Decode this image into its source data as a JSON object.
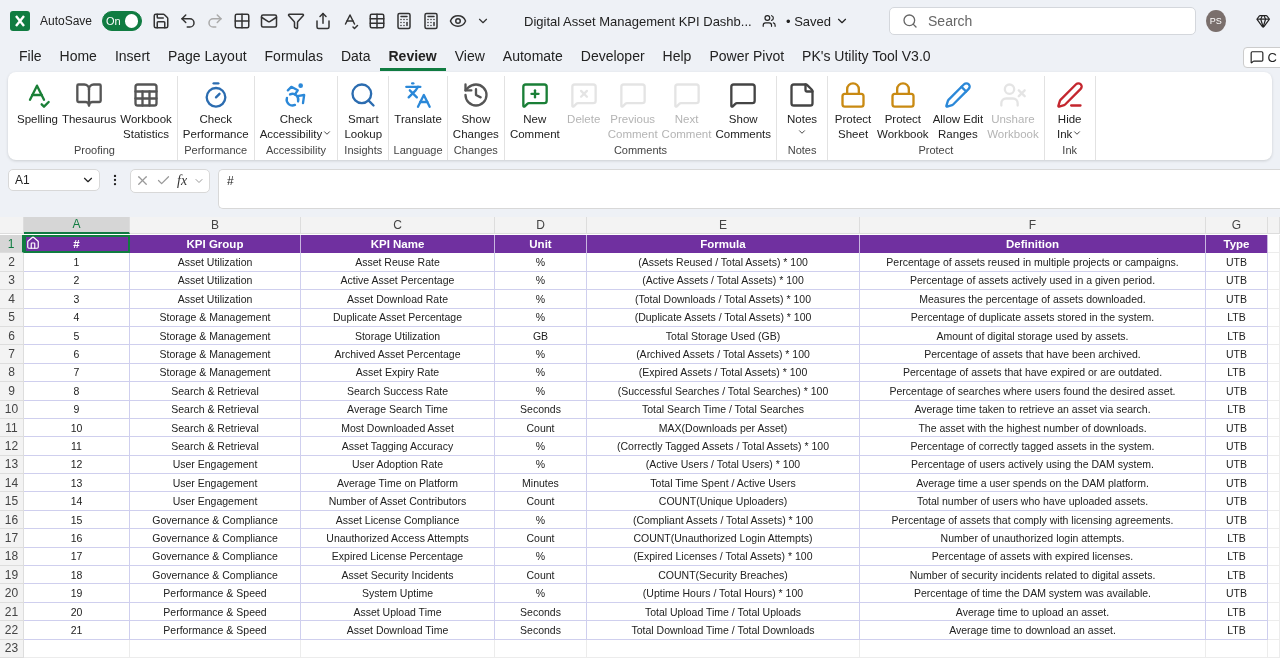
{
  "title_bar": {
    "autosave": {
      "label": "AutoSave",
      "on": true,
      "state": "On"
    },
    "document_title": "Digital Asset Management KPI Dashb...",
    "save_status": "• Saved",
    "search": {
      "placeholder": "Search"
    },
    "avatar": "PS"
  },
  "menu_tabs": [
    {
      "label": "File",
      "selected": false
    },
    {
      "label": "Home",
      "selected": false
    },
    {
      "label": "Insert",
      "selected": false
    },
    {
      "label": "Page Layout",
      "selected": false
    },
    {
      "label": "Formulas",
      "selected": false
    },
    {
      "label": "Data",
      "selected": false
    },
    {
      "label": "Review",
      "selected": true
    },
    {
      "label": "View",
      "selected": false
    },
    {
      "label": "Automate",
      "selected": false
    },
    {
      "label": "Developer",
      "selected": false
    },
    {
      "label": "Help",
      "selected": false
    },
    {
      "label": "Power Pivot",
      "selected": false
    },
    {
      "label": "PK's Utility Tool V3.0",
      "selected": false
    }
  ],
  "comments_button": {
    "label": "C"
  },
  "ribbon": {
    "groups": [
      {
        "label": "Proofing",
        "commands": [
          {
            "lines": [
              "Spelling"
            ],
            "disabled": false,
            "dropdown": false
          },
          {
            "lines": [
              "Thesaurus"
            ],
            "disabled": false,
            "dropdown": false
          },
          {
            "lines": [
              "Workbook",
              "Statistics"
            ],
            "disabled": false,
            "dropdown": false
          }
        ]
      },
      {
        "label": "Performance",
        "commands": [
          {
            "lines": [
              "Check",
              "Performance"
            ],
            "disabled": false,
            "dropdown": false
          }
        ]
      },
      {
        "label": "Accessibility",
        "commands": [
          {
            "lines": [
              "Check",
              "Accessibility"
            ],
            "disabled": false,
            "dropdown": true
          }
        ]
      },
      {
        "label": "Insights",
        "commands": [
          {
            "lines": [
              "Smart",
              "Lookup"
            ],
            "disabled": false,
            "dropdown": false
          }
        ]
      },
      {
        "label": "Language",
        "commands": [
          {
            "lines": [
              "Translate"
            ],
            "disabled": false,
            "dropdown": false
          }
        ]
      },
      {
        "label": "Changes",
        "commands": [
          {
            "lines": [
              "Show",
              "Changes"
            ],
            "disabled": false,
            "dropdown": false
          }
        ]
      },
      {
        "label": "Comments",
        "commands": [
          {
            "lines": [
              "New",
              "Comment"
            ],
            "disabled": false,
            "dropdown": false
          },
          {
            "lines": [
              "Delete"
            ],
            "disabled": true,
            "dropdown": false
          },
          {
            "lines": [
              "Previous",
              "Comment"
            ],
            "disabled": true,
            "dropdown": false
          },
          {
            "lines": [
              "Next",
              "Comment"
            ],
            "disabled": true,
            "dropdown": false
          },
          {
            "lines": [
              "Show",
              "Comments"
            ],
            "disabled": false,
            "dropdown": false
          }
        ]
      },
      {
        "label": "Notes",
        "commands": [
          {
            "lines": [
              "Notes"
            ],
            "disabled": false,
            "dropdown": true
          }
        ]
      },
      {
        "label": "Protect",
        "commands": [
          {
            "lines": [
              "Protect",
              "Sheet"
            ],
            "disabled": false,
            "dropdown": false
          },
          {
            "lines": [
              "Protect",
              "Workbook"
            ],
            "disabled": false,
            "dropdown": false
          },
          {
            "lines": [
              "Allow Edit",
              "Ranges"
            ],
            "disabled": false,
            "dropdown": false
          },
          {
            "lines": [
              "Unshare",
              "Workbook"
            ],
            "disabled": true,
            "dropdown": false
          }
        ]
      },
      {
        "label": "Ink",
        "commands": [
          {
            "lines": [
              "Hide",
              "Ink"
            ],
            "disabled": false,
            "dropdown": true
          }
        ]
      }
    ]
  },
  "formula_bar": {
    "name_box": "A1",
    "function_label": "fx",
    "formula": "#"
  },
  "sheet": {
    "columns": [
      {
        "letter": "A",
        "selected": true
      },
      {
        "letter": "B",
        "selected": false
      },
      {
        "letter": "C",
        "selected": false
      },
      {
        "letter": "D",
        "selected": false
      },
      {
        "letter": "E",
        "selected": false
      },
      {
        "letter": "F",
        "selected": false
      },
      {
        "letter": "G",
        "selected": false
      }
    ],
    "row_headers": [
      {
        "label": "1",
        "selected": true
      },
      {
        "label": "2",
        "selected": false
      },
      {
        "label": "3",
        "selected": false
      },
      {
        "label": "4",
        "selected": false
      },
      {
        "label": "5",
        "selected": false
      },
      {
        "label": "6",
        "selected": false
      },
      {
        "label": "7",
        "selected": false
      },
      {
        "label": "8",
        "selected": false
      },
      {
        "label": "9",
        "selected": false
      },
      {
        "label": "10",
        "selected": false
      },
      {
        "label": "11",
        "selected": false
      },
      {
        "label": "12",
        "selected": false
      },
      {
        "label": "13",
        "selected": false
      },
      {
        "label": "14",
        "selected": false
      },
      {
        "label": "15",
        "selected": false
      },
      {
        "label": "16",
        "selected": false
      },
      {
        "label": "17",
        "selected": false
      },
      {
        "label": "18",
        "selected": false
      },
      {
        "label": "19",
        "selected": false
      },
      {
        "label": "20",
        "selected": false
      },
      {
        "label": "21",
        "selected": false
      },
      {
        "label": "22",
        "selected": false
      },
      {
        "label": "23",
        "selected": false
      }
    ],
    "header": [
      "#",
      "KPI Group",
      "KPI Name",
      "Unit",
      "Formula",
      "Definition",
      "Type"
    ],
    "rows": [
      [
        "1",
        "Asset Utilization",
        "Asset Reuse Rate",
        "%",
        "(Assets Reused / Total Assets) * 100",
        "Percentage of assets reused in multiple projects or campaigns.",
        "UTB"
      ],
      [
        "2",
        "Asset Utilization",
        "Active Asset Percentage",
        "%",
        "(Active Assets / Total Assets) * 100",
        "Percentage of assets actively used in a given period.",
        "UTB"
      ],
      [
        "3",
        "Asset Utilization",
        "Asset Download Rate",
        "%",
        "(Total Downloads / Total Assets) * 100",
        "Measures the percentage of assets downloaded.",
        "UTB"
      ],
      [
        "4",
        "Storage & Management",
        "Duplicate Asset Percentage",
        "%",
        "(Duplicate Assets / Total Assets) * 100",
        "Percentage of duplicate assets stored in the system.",
        "LTB"
      ],
      [
        "5",
        "Storage & Management",
        "Storage Utilization",
        "GB",
        "Total Storage Used (GB)",
        "Amount of digital storage used by assets.",
        "LTB"
      ],
      [
        "6",
        "Storage & Management",
        "Archived Asset Percentage",
        "%",
        "(Archived Assets / Total Assets) * 100",
        "Percentage of assets that have been archived.",
        "UTB"
      ],
      [
        "7",
        "Storage & Management",
        "Asset Expiry Rate",
        "%",
        "(Expired Assets / Total Assets) * 100",
        "Percentage of assets that have expired or are outdated.",
        "LTB"
      ],
      [
        "8",
        "Search & Retrieval",
        "Search Success Rate",
        "%",
        "(Successful Searches / Total Searches) * 100",
        "Percentage of searches where users found the desired asset.",
        "UTB"
      ],
      [
        "9",
        "Search & Retrieval",
        "Average Search Time",
        "Seconds",
        "Total Search Time / Total Searches",
        "Average time taken to retrieve an asset via search.",
        "LTB"
      ],
      [
        "10",
        "Search & Retrieval",
        "Most Downloaded Asset",
        "Count",
        "MAX(Downloads per Asset)",
        "The asset with the highest number of downloads.",
        "UTB"
      ],
      [
        "11",
        "Search & Retrieval",
        "Asset Tagging Accuracy",
        "%",
        "(Correctly Tagged Assets / Total Assets) * 100",
        "Percentage of correctly tagged assets in the system.",
        "UTB"
      ],
      [
        "12",
        "User Engagement",
        "User Adoption Rate",
        "%",
        "(Active Users / Total Users) * 100",
        "Percentage of users actively using the DAM system.",
        "UTB"
      ],
      [
        "13",
        "User Engagement",
        "Average Time on Platform",
        "Minutes",
        "Total Time Spent / Active Users",
        "Average time a user spends on the DAM platform.",
        "UTB"
      ],
      [
        "14",
        "User Engagement",
        "Number of Asset Contributors",
        "Count",
        "COUNT(Unique Uploaders)",
        "Total number of users who have uploaded assets.",
        "UTB"
      ],
      [
        "15",
        "Governance & Compliance",
        "Asset License Compliance",
        "%",
        "(Compliant Assets / Total Assets) * 100",
        "Percentage of assets that comply with licensing agreements.",
        "UTB"
      ],
      [
        "16",
        "Governance & Compliance",
        "Unauthorized Access Attempts",
        "Count",
        "COUNT(Unauthorized Login Attempts)",
        "Number of unauthorized login attempts.",
        "LTB"
      ],
      [
        "17",
        "Governance & Compliance",
        "Expired License Percentage",
        "%",
        "(Expired Licenses / Total Assets) * 100",
        "Percentage of assets with expired licenses.",
        "LTB"
      ],
      [
        "18",
        "Governance & Compliance",
        "Asset Security Incidents",
        "Count",
        "COUNT(Security Breaches)",
        "Number of security incidents related to digital assets.",
        "LTB"
      ],
      [
        "19",
        "Performance & Speed",
        "System Uptime",
        "%",
        "(Uptime Hours / Total Hours) * 100",
        "Percentage of time the DAM system was available.",
        "UTB"
      ],
      [
        "20",
        "Performance & Speed",
        "Asset Upload Time",
        "Seconds",
        "Total Upload Time / Total Uploads",
        "Average time to upload an asset.",
        "LTB"
      ],
      [
        "21",
        "Performance & Speed",
        "Asset Download Time",
        "Seconds",
        "Total Download Time / Total Downloads",
        "Average time to download an asset.",
        "LTB"
      ]
    ]
  }
}
